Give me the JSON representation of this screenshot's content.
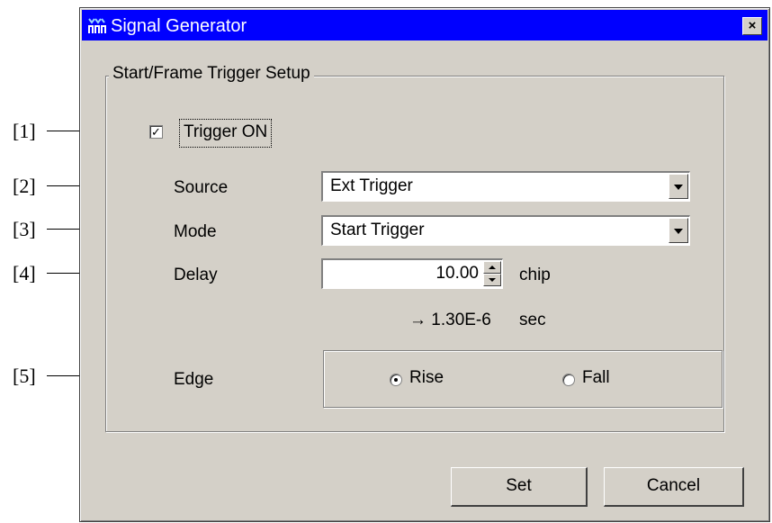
{
  "callouts": [
    "[1]",
    "[2]",
    "[3]",
    "[4]",
    "[5]"
  ],
  "window": {
    "title": "Signal Generator",
    "close_label": "×"
  },
  "group": {
    "title": "Start/Frame Trigger Setup"
  },
  "trigger": {
    "checked": true,
    "check_mark": "✓",
    "label": "Trigger ON"
  },
  "source": {
    "label": "Source",
    "value": "Ext Trigger"
  },
  "mode": {
    "label": "Mode",
    "value": "Start Trigger"
  },
  "delay": {
    "label": "Delay",
    "value": "10.00",
    "unit": "chip",
    "converted": "→ 1.30E-6",
    "converted_unit": "sec"
  },
  "edge": {
    "label": "Edge",
    "options": [
      {
        "label": "Rise",
        "selected": true
      },
      {
        "label": "Fall",
        "selected": false
      }
    ]
  },
  "buttons": {
    "set": "Set",
    "cancel": "Cancel"
  },
  "colors": {
    "titlebar": "#0000ff",
    "dialog_bg": "#d4d0c8"
  }
}
